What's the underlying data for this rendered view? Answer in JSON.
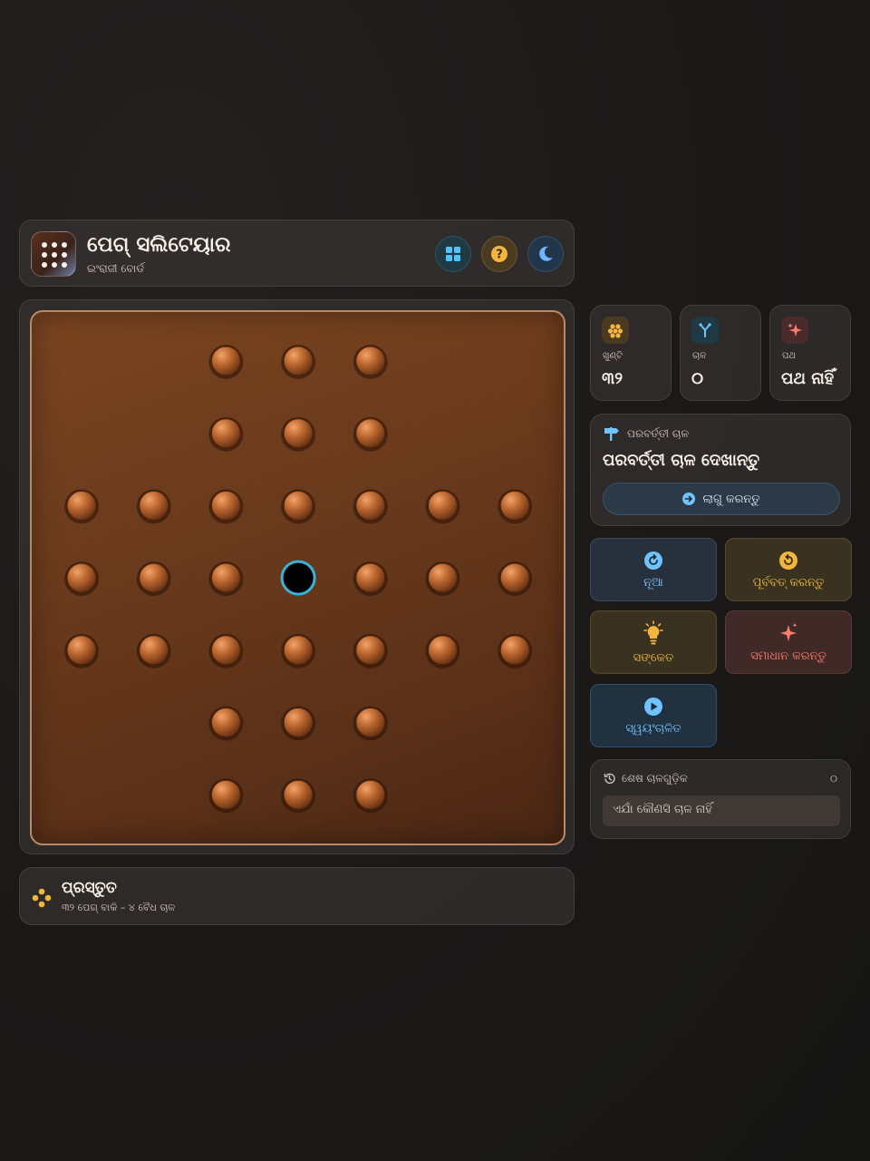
{
  "header": {
    "title": "ପେଗ୍ ସଲିଟେୟାର",
    "subtitle": "ଇଂରାଜୀ ବୋର୍ଡ"
  },
  "header_buttons": [
    {
      "icon": "grid-icon",
      "color": "#4fc3f7"
    },
    {
      "icon": "help-icon",
      "color": "#f2b640"
    },
    {
      "icon": "moon-icon",
      "color": "#6fb6ff"
    }
  ],
  "board": {
    "rows": [
      "..OOO..",
      "..OOO..",
      "OOOOOOO",
      "OOO.OOO",
      "OOOOOOO",
      "..OOO..",
      "..OOO.."
    ],
    "selected_hole": [
      3,
      3
    ],
    "peg_color": "#b45f2c",
    "highlight_color": "#3ab3d6"
  },
  "stats": [
    {
      "label": "ଖୁଣ୍ଟି",
      "value": "୩୨",
      "icon": "pegs-icon",
      "color": "#f2b640"
    },
    {
      "label": "ଚାଳ",
      "value": "୦",
      "icon": "branch-icon",
      "color": "#6fc3ff"
    },
    {
      "label": "ପଥ",
      "value": "ପଥ ନାହିଁ",
      "icon": "sparkle-icon",
      "color": "#ff7a6a"
    }
  ],
  "next_move": {
    "label": "ପରବର୍ତ୍ତୀ ଚାଳ",
    "headline": "ପରବର୍ତ୍ତୀ ଚାଳ ଦେଖାନ୍ତୁ",
    "apply_label": "ଲାଗୁ କରନ୍ତୁ"
  },
  "actions": {
    "new_label": "ନୂଆ",
    "undo_label": "ପୂର୍ବବତ୍ କରନ୍ତୁ",
    "hint_label": "ସଙ୍କେତ",
    "solve_label": "ସମାଧାନ କରନ୍ତୁ",
    "auto_label": "ସ୍ୱୟଂଚାଳିତ"
  },
  "history": {
    "label": "ଶେଷ ଚାଳଗୁଡ଼ିକ",
    "count": "୦",
    "empty_text": "ଏଯାଁ କୌଣସି ଚାଳ ନାହିଁ"
  },
  "status": {
    "title": "ପ୍ରସ୍ତୁତ",
    "detail": "୩୨ ପେଗ୍ ବାକି – ୪ ବୈଧ ଚାଳ"
  }
}
